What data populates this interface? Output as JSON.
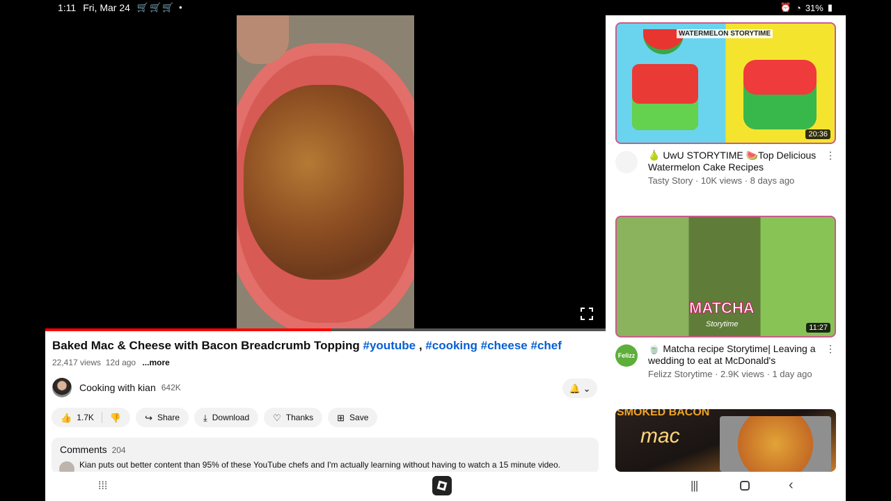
{
  "status_bar": {
    "time": "1:11",
    "date": "Fri, Mar 24",
    "notification_icons": "🛒🛒🛒 •",
    "battery": "31%"
  },
  "player": {
    "progress_fraction": 0.51
  },
  "video": {
    "title": "Baked Mac & Cheese with Bacon Breadcrumb Topping",
    "hashtags": [
      "#youtube",
      ",",
      "#cooking",
      "#cheese",
      "#chef"
    ],
    "views": "22,417 views",
    "age": "12d ago",
    "more": "...more"
  },
  "channel": {
    "name": "Cooking with kian",
    "subscribers": "642K"
  },
  "actions": {
    "likes": "1.7K",
    "share": "Share",
    "download": "Download",
    "thanks": "Thanks",
    "save": "Save"
  },
  "comments": {
    "label": "Comments",
    "count": "204",
    "top_comment": "Kian puts out better content than 95% of these YouTube chefs and I'm actually learning without having to watch a 15 minute video."
  },
  "sidebar": {
    "items": [
      {
        "thumb_text": "WATERMELON STORYTIME",
        "duration": "20:36",
        "title": "🍐 UwU STORYTIME 🍉Top Delicious Watermelon Cake Recipes",
        "channel": "Tasty Story",
        "views": "10K views",
        "age": "8 days ago"
      },
      {
        "thumb_text": "MATCHA",
        "thumb_subtext": "Storytime",
        "duration": "11:27",
        "title": "🍵 Matcha recipe Storytime| Leaving a wedding to eat at McDonald's",
        "channel": "Felizz Storytime",
        "channel_avatar_text": "Felizz",
        "views": "2.9K views",
        "age": "1 day ago"
      },
      {
        "thumb_text": "SMOKED BACON",
        "thumb_subtext": "mac"
      }
    ]
  }
}
